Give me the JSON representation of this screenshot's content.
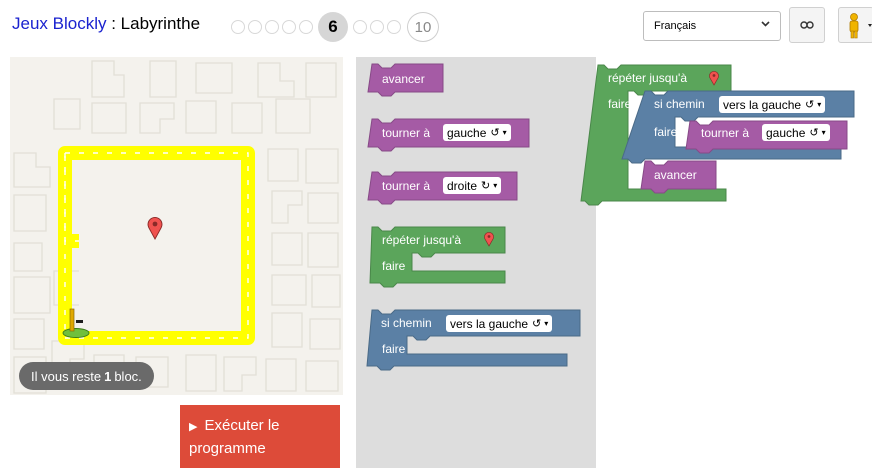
{
  "header": {
    "app_title": "Jeux Blockly",
    "separator": " : ",
    "game_name": "Labyrinthe",
    "current_level": "6",
    "last_level": "10"
  },
  "language": {
    "selected": "Français",
    "chevron": "⌄"
  },
  "maze": {
    "capacity_prefix": "Il vous reste",
    "capacity_count": "1",
    "capacity_suffix": "bloc."
  },
  "run_button": {
    "label_line1": "Exécuter le",
    "label_line2": "programme",
    "icon": "▶"
  },
  "toolbox": {
    "move_forward": "avancer",
    "turn_left_label": "tourner à",
    "turn_left_value": "gauche",
    "turn_right_label": "tourner à",
    "turn_right_value": "droite",
    "repeat_label": "répéter jusqu'à",
    "repeat_do": "faire",
    "if_label": "si chemin",
    "if_value": "vers la gauche",
    "if_do": "faire"
  },
  "workspace": {
    "repeat_label": "répéter jusqu'à",
    "repeat_do": "faire",
    "if_label": "si chemin",
    "if_value": "vers la gauche",
    "if_do": "faire",
    "turn_label": "tourner à",
    "turn_value": "gauche",
    "move_forward": "avancer"
  },
  "icons": {
    "turn_left_symbol": "↺",
    "turn_right_symbol": "↻",
    "dropdown_symbol": "▾"
  },
  "colors": {
    "movement": "#a55ba5",
    "loop": "#5ba55b",
    "logic": "#5b80a5",
    "path": "#ffff00",
    "run_button": "#dd4b39",
    "marker": "#f0524f"
  }
}
